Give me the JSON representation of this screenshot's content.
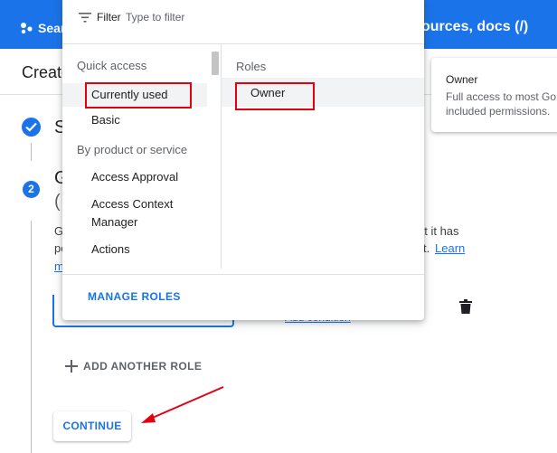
{
  "topbar": {
    "search_label": "Sear",
    "search_tail": "ources, docs (/)"
  },
  "page": {
    "title": "Create",
    "step1_title_frag": "S",
    "step2_number": "2",
    "step2_title_frag": "G",
    "step2_sub_frag": "(",
    "desc_line1_left": "G",
    "desc_line1_right": "at it has",
    "desc_line2_left": "pe",
    "desc_line2_right": "t.",
    "learn_right": "Learn",
    "learn_left": "m"
  },
  "owner_card": {
    "title": "Owner",
    "description": "Full access to most Go included permissions."
  },
  "role_form": {
    "add_condition": "Add condition",
    "add_another_role": "ADD ANOTHER ROLE",
    "continue": "CONTINUE"
  },
  "dropdown": {
    "filter_label": "Filter",
    "filter_placeholder": "Type to filter",
    "groups": [
      {
        "label": "Quick access",
        "items": [
          "Currently used",
          "Basic"
        ]
      },
      {
        "label": "By product or service",
        "items": [
          "Access Approval",
          "Access Context Manager",
          "Actions"
        ]
      }
    ],
    "roles_label": "Roles",
    "roles": [
      "Owner"
    ],
    "manage_roles": "MANAGE ROLES"
  },
  "colors": {
    "accent": "#1a73e8",
    "highlight_box": "#e3000f",
    "selected_row": "#f1f3f4"
  }
}
